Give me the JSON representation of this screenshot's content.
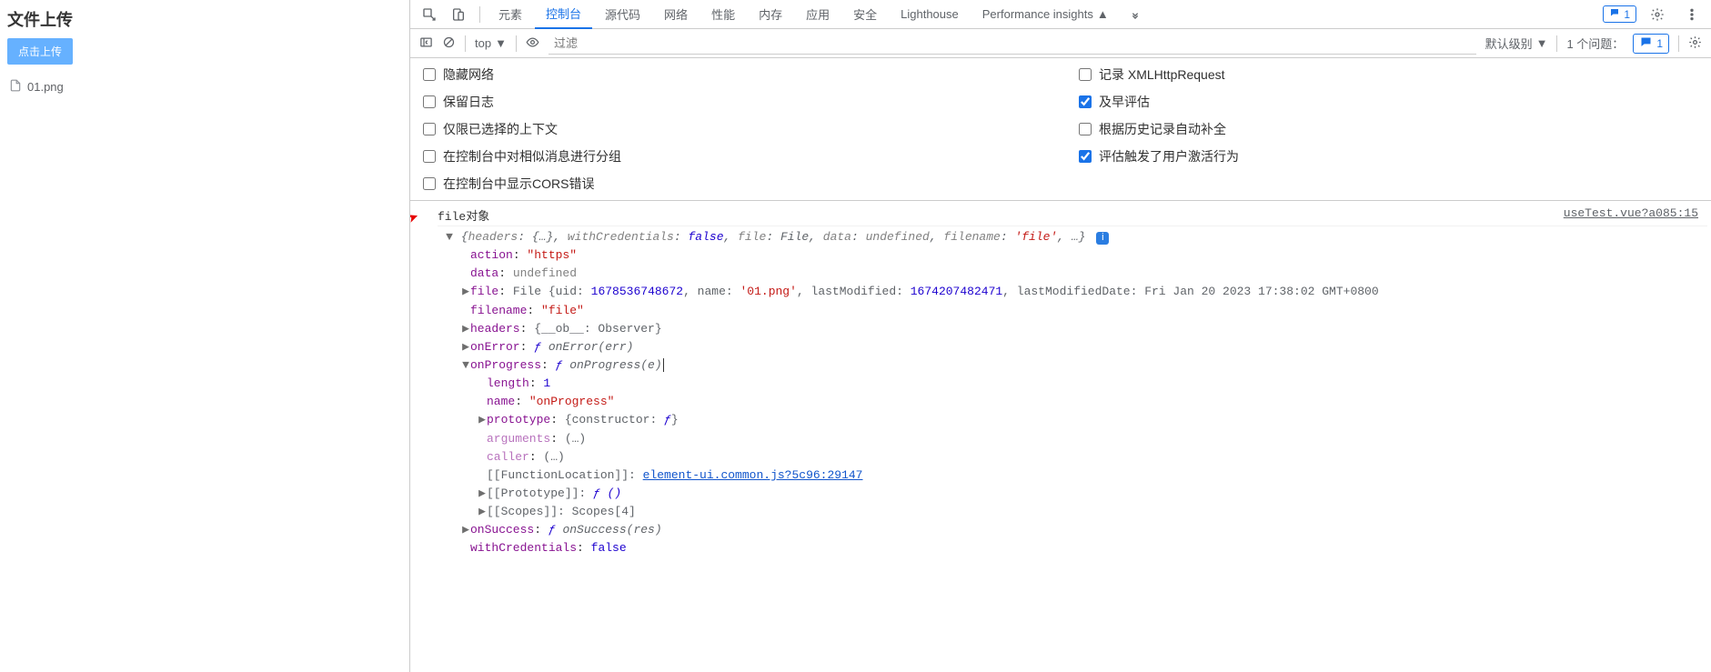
{
  "left": {
    "title": "文件上传",
    "button": "点击上传",
    "fileName": "01.png"
  },
  "tabs": [
    "元素",
    "控制台",
    "源代码",
    "网络",
    "性能",
    "内存",
    "应用",
    "安全",
    "Lighthouse",
    "Performance insights"
  ],
  "activeTab": "控制台",
  "toolbarRight": {
    "msgCount": "1"
  },
  "toolbar2": {
    "context": "top",
    "filterPlaceholder": "过滤",
    "level": "默认级别",
    "issuesLabel": "1 个问题：",
    "issuesCount": "1"
  },
  "options": {
    "left": [
      "隐藏网络",
      "保留日志",
      "仅限已选择的上下文",
      "在控制台中对相似消息进行分组",
      "在控制台中显示CORS错误"
    ],
    "right": [
      {
        "label": "记录 XMLHttpRequest",
        "checked": false
      },
      {
        "label": "及早评估",
        "checked": true
      },
      {
        "label": "根据历史记录自动补全",
        "checked": false
      },
      {
        "label": "评估触发了用户激活行为",
        "checked": true
      }
    ]
  },
  "console": {
    "heading": "file对象",
    "sourceLink": "useTest.vue?a085:15",
    "summary": {
      "withCredentials": "false",
      "fileLabel": "File",
      "dataLabel": "undefined",
      "filename": "'file'"
    },
    "tree": {
      "action": "\"https\"",
      "data": "undefined",
      "file": {
        "uid": "1678536748672",
        "name": "'01.png'",
        "lastModified": "1674207482471",
        "tail": "lastModifiedDate: Fri Jan 20 2023 17:38:02 GMT+0800"
      },
      "filename": "\"file\"",
      "headers": "{__ob__: Observer}",
      "onError": "onError(err)",
      "onProgress": {
        "sig": "onProgress(e)",
        "length": "1",
        "name": "\"onProgress\"",
        "prototype": "{constructor: ƒ}",
        "arguments": "(…)",
        "caller": "(…)",
        "funcLocLabel": "[[FunctionLocation]]",
        "funcLoc": "element-ui.common.js?5c96:29147",
        "protoLabel": "[[Prototype]]",
        "proto": "ƒ ()",
        "scopesLabel": "[[Scopes]]",
        "scopes": "Scopes[4]"
      },
      "onSuccess": "onSuccess(res)",
      "withCredentials": "false"
    }
  }
}
